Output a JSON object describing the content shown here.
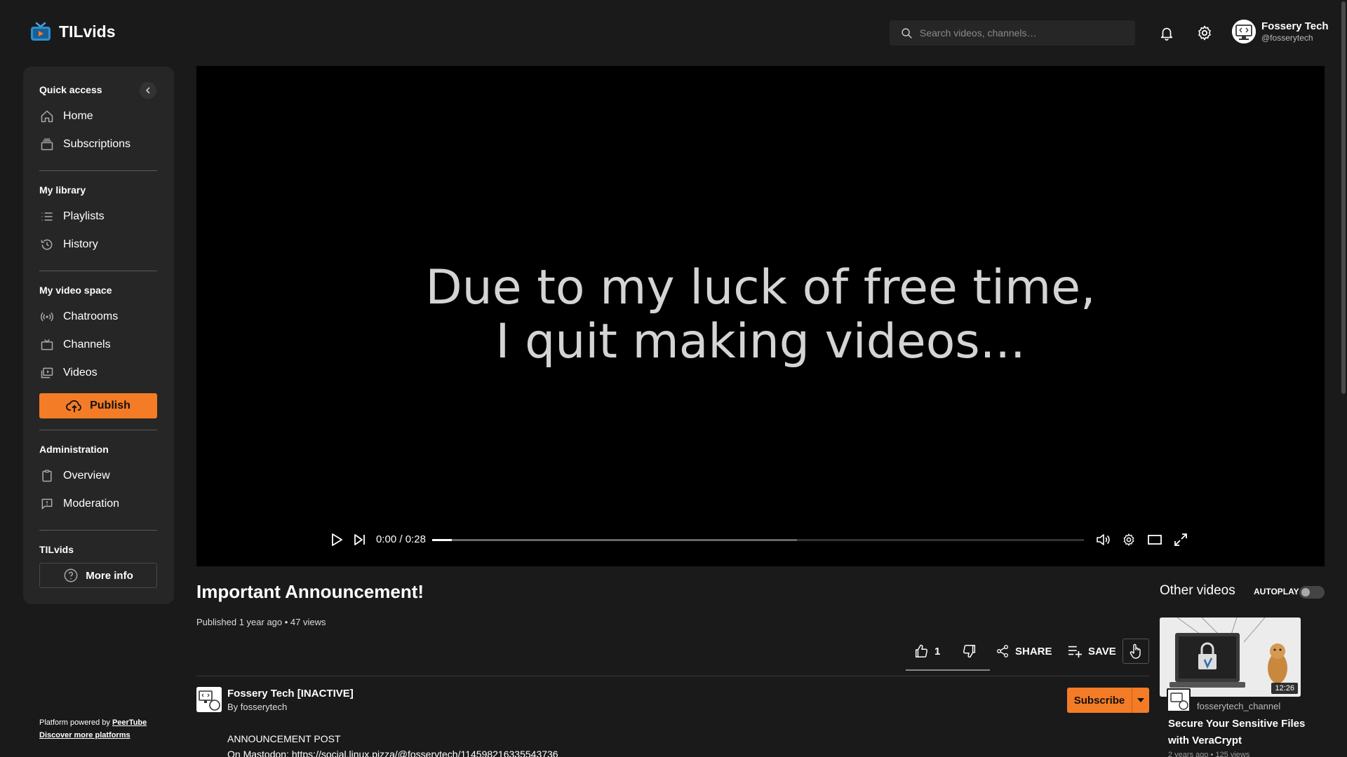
{
  "app": {
    "name": "TILvids"
  },
  "header": {
    "search_placeholder": "Search videos, channels…",
    "user": {
      "name": "Fossery Tech",
      "handle": "@fosserytech"
    }
  },
  "sidebar": {
    "quick_access": {
      "title": "Quick access",
      "items": [
        {
          "label": "Home",
          "icon": "home-icon"
        },
        {
          "label": "Subscriptions",
          "icon": "subscriptions-icon"
        }
      ]
    },
    "library": {
      "title": "My library",
      "items": [
        {
          "label": "Playlists",
          "icon": "list-icon"
        },
        {
          "label": "History",
          "icon": "history-icon"
        }
      ]
    },
    "video_space": {
      "title": "My video space",
      "items": [
        {
          "label": "Chatrooms",
          "icon": "broadcast-icon"
        },
        {
          "label": "Channels",
          "icon": "tv-icon"
        },
        {
          "label": "Videos",
          "icon": "videos-icon"
        }
      ]
    },
    "publish_label": "Publish",
    "administration": {
      "title": "Administration",
      "items": [
        {
          "label": "Overview",
          "icon": "clipboard-icon"
        },
        {
          "label": "Moderation",
          "icon": "flag-message-icon"
        }
      ]
    },
    "instance": {
      "title": "TILvids",
      "more_info_label": "More info"
    },
    "footer": {
      "powered_prefix": "Platform powered by ",
      "powered_link": "PeerTube",
      "discover": "Discover more platforms"
    }
  },
  "player": {
    "overlay_line1": "Due to my luck of free time,",
    "overlay_line2": "I quit making videos...",
    "current_time": "0:00",
    "duration": "0:28",
    "progress": 0.03,
    "buffered": 0.56
  },
  "video": {
    "title": "Important Announcement!",
    "meta": "Published 1 year ago • 47 views",
    "likes": "1",
    "share_label": "SHARE",
    "save_label": "SAVE",
    "channel_name": "Fossery Tech [INACTIVE]",
    "channel_by": "By fosserytech",
    "subscribe_label": "Subscribe",
    "description_line1": "ANNOUNCEMENT POST",
    "description_line2": "On Mastodon: https://social.linux.pizza/@fosserytech/114598216335543736"
  },
  "sidebar_right": {
    "title": "Other videos",
    "autoplay_label": "AUTOPLAY",
    "autoplay_on": false,
    "recommended": {
      "duration": "12:26",
      "channel": "fosserytech_channel",
      "title": "Secure Your Sensitive Files with VeraCrypt",
      "meta": "2 years ago • 125 views"
    }
  },
  "colors": {
    "accent": "#f47c26",
    "background": "#1a1a1a",
    "panel": "#262626"
  }
}
